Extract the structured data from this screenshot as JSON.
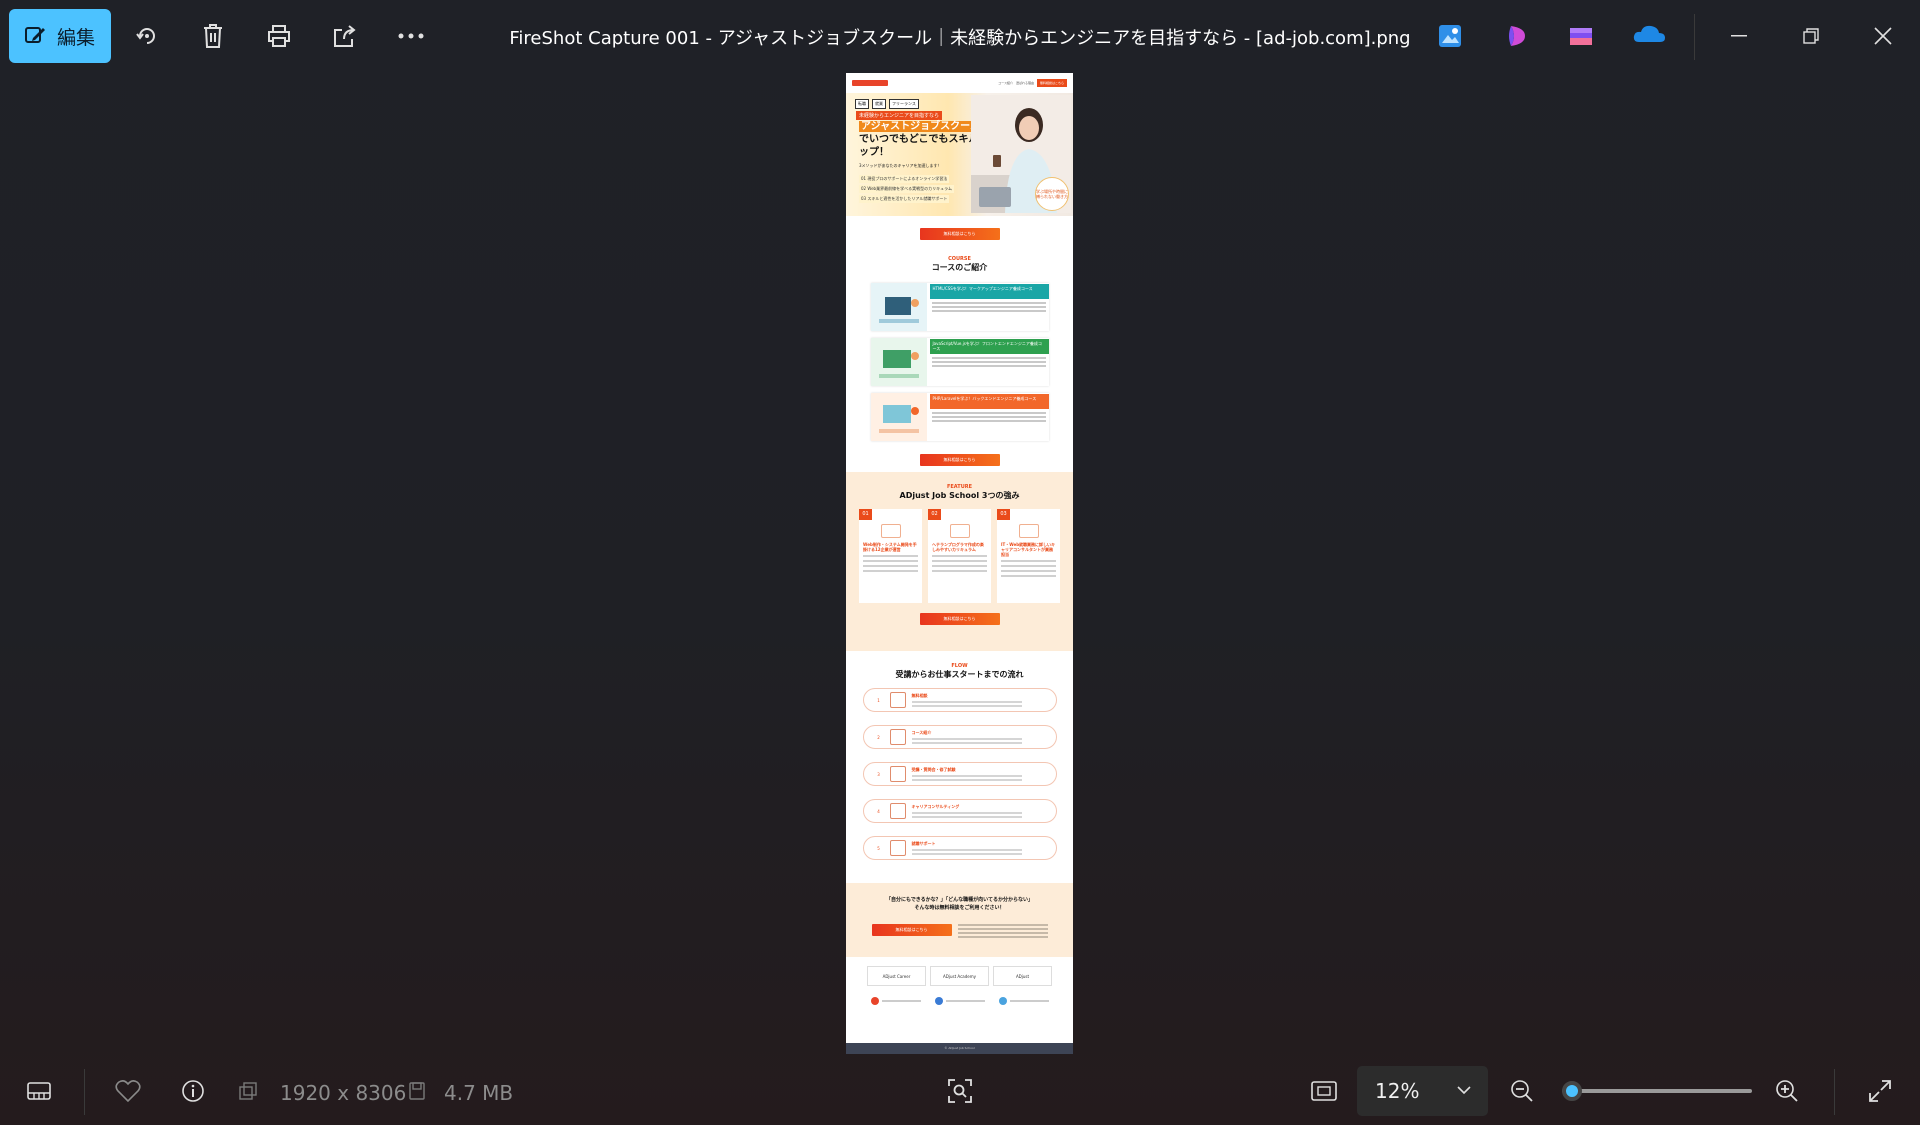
{
  "toolbar": {
    "edit_label": "編集",
    "title": "FireShot Capture 001 - アジャストジョブスクール｜未経験からエンジニアを目指すなら - [ad-job.com].png"
  },
  "status": {
    "dimensions": "1920 x 8306",
    "file_size": "4.7 MB",
    "zoom": "12%",
    "zoom_percent": 12
  },
  "icons": [
    "edit-icon",
    "rotate-icon",
    "delete-icon",
    "print-icon",
    "share-icon",
    "more-icon",
    "photos-icon",
    "clipchamp-icon",
    "movie-icon",
    "onedrive-icon",
    "minimize-icon",
    "restore-icon",
    "close-icon",
    "filmstrip-icon",
    "heart-icon",
    "info-icon",
    "dimensions-icon",
    "filesize-icon",
    "visual-search-icon",
    "fit-icon",
    "zoom-out-icon",
    "zoom-in-icon",
    "fullscreen-icon"
  ],
  "colors": {
    "accent": "#4cc2ff",
    "brand": "#ea4b1a"
  },
  "document": {
    "tags": [
      "転職",
      "就業",
      "フリーランス"
    ],
    "hero_badge": "未経験からエンジニアを目指すなら",
    "hero_title_highlight": "アジャストジョブスクール",
    "hero_title_rest": "でいつでもどこでもスキルアップ！",
    "hero_lead": "3メソッドがあなたのキャリアを加速します！",
    "hero_points": [
      "01 現役プロのサポートによるオンライン学習法",
      "02 Web業界最前線を学べる実戦型のカリキュラム",
      "03 スキルと適性を活かしたリアル就職サポート"
    ],
    "hero_bubble": "学ぶ場所や時間に縛られない働き方",
    "cta_label": "無料相談はこちら",
    "course_en": "COURSE",
    "course_jp": "コースのご紹介",
    "courses": [
      {
        "title": "HTML/CSSを学ぶ！マークアップエンジニア養成コース",
        "color": "#1aa6a6"
      },
      {
        "title": "JavaScript/Vue.jsを学ぶ！フロントエンドエンジニア養成コース",
        "color": "#2ea04f"
      },
      {
        "title": "PHP/Laravelを学ぶ！バックエンドエンジニア養成コース",
        "color": "#f2672a"
      }
    ],
    "feature_en": "FEATURE",
    "feature_jp": "ADjust Job School 3つの強み",
    "features": [
      {
        "num": "01",
        "title": "Web制作・システム開発を手掛ける12企業が運営"
      },
      {
        "num": "02",
        "title": "ヘテランプログラマ作成の楽しみやすいカリキュラム"
      },
      {
        "num": "03",
        "title": "IT・Web就職業務に詳しいキャリアコンサルタントが業務担当"
      }
    ],
    "flow_en": "FLOW",
    "flow_jp": "受講からお仕事スタートまでの流れ",
    "steps": [
      {
        "num": "1",
        "title": "無料相談"
      },
      {
        "num": "2",
        "title": "コース紹介"
      },
      {
        "num": "3",
        "title": "受講・質問会・修了試験"
      },
      {
        "num": "4",
        "title": "キャリアコンサルティング"
      },
      {
        "num": "5",
        "title": "就職サポート"
      }
    ],
    "consult_q1": "「自分にもできるかな？」「どんな職種が向いてるか分からない」",
    "consult_q2": "そんな時は無料相談をご利用ください！",
    "brands": [
      "ADjust Career",
      "ADjust Academy",
      "ADjust"
    ],
    "footer": "© ADjust Job School"
  }
}
